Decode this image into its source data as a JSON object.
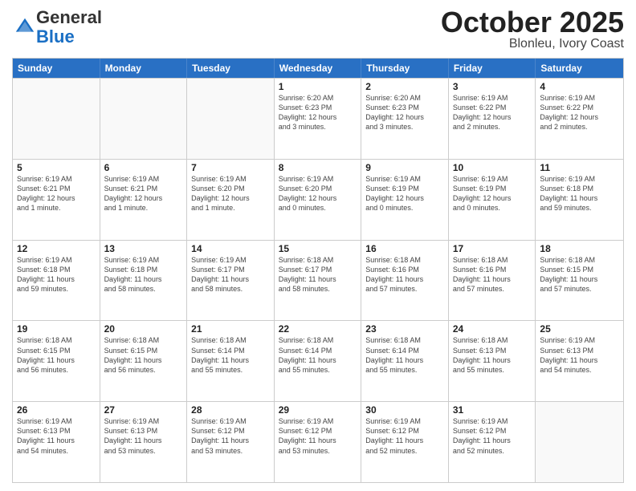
{
  "logo": {
    "general": "General",
    "blue": "Blue"
  },
  "header": {
    "month": "October 2025",
    "location": "Blonleu, Ivory Coast"
  },
  "weekdays": [
    "Sunday",
    "Monday",
    "Tuesday",
    "Wednesday",
    "Thursday",
    "Friday",
    "Saturday"
  ],
  "weeks": [
    [
      {
        "day": "",
        "info": ""
      },
      {
        "day": "",
        "info": ""
      },
      {
        "day": "",
        "info": ""
      },
      {
        "day": "1",
        "info": "Sunrise: 6:20 AM\nSunset: 6:23 PM\nDaylight: 12 hours\nand 3 minutes."
      },
      {
        "day": "2",
        "info": "Sunrise: 6:20 AM\nSunset: 6:23 PM\nDaylight: 12 hours\nand 3 minutes."
      },
      {
        "day": "3",
        "info": "Sunrise: 6:19 AM\nSunset: 6:22 PM\nDaylight: 12 hours\nand 2 minutes."
      },
      {
        "day": "4",
        "info": "Sunrise: 6:19 AM\nSunset: 6:22 PM\nDaylight: 12 hours\nand 2 minutes."
      }
    ],
    [
      {
        "day": "5",
        "info": "Sunrise: 6:19 AM\nSunset: 6:21 PM\nDaylight: 12 hours\nand 1 minute."
      },
      {
        "day": "6",
        "info": "Sunrise: 6:19 AM\nSunset: 6:21 PM\nDaylight: 12 hours\nand 1 minute."
      },
      {
        "day": "7",
        "info": "Sunrise: 6:19 AM\nSunset: 6:20 PM\nDaylight: 12 hours\nand 1 minute."
      },
      {
        "day": "8",
        "info": "Sunrise: 6:19 AM\nSunset: 6:20 PM\nDaylight: 12 hours\nand 0 minutes."
      },
      {
        "day": "9",
        "info": "Sunrise: 6:19 AM\nSunset: 6:19 PM\nDaylight: 12 hours\nand 0 minutes."
      },
      {
        "day": "10",
        "info": "Sunrise: 6:19 AM\nSunset: 6:19 PM\nDaylight: 12 hours\nand 0 minutes."
      },
      {
        "day": "11",
        "info": "Sunrise: 6:19 AM\nSunset: 6:18 PM\nDaylight: 11 hours\nand 59 minutes."
      }
    ],
    [
      {
        "day": "12",
        "info": "Sunrise: 6:19 AM\nSunset: 6:18 PM\nDaylight: 11 hours\nand 59 minutes."
      },
      {
        "day": "13",
        "info": "Sunrise: 6:19 AM\nSunset: 6:18 PM\nDaylight: 11 hours\nand 58 minutes."
      },
      {
        "day": "14",
        "info": "Sunrise: 6:19 AM\nSunset: 6:17 PM\nDaylight: 11 hours\nand 58 minutes."
      },
      {
        "day": "15",
        "info": "Sunrise: 6:18 AM\nSunset: 6:17 PM\nDaylight: 11 hours\nand 58 minutes."
      },
      {
        "day": "16",
        "info": "Sunrise: 6:18 AM\nSunset: 6:16 PM\nDaylight: 11 hours\nand 57 minutes."
      },
      {
        "day": "17",
        "info": "Sunrise: 6:18 AM\nSunset: 6:16 PM\nDaylight: 11 hours\nand 57 minutes."
      },
      {
        "day": "18",
        "info": "Sunrise: 6:18 AM\nSunset: 6:15 PM\nDaylight: 11 hours\nand 57 minutes."
      }
    ],
    [
      {
        "day": "19",
        "info": "Sunrise: 6:18 AM\nSunset: 6:15 PM\nDaylight: 11 hours\nand 56 minutes."
      },
      {
        "day": "20",
        "info": "Sunrise: 6:18 AM\nSunset: 6:15 PM\nDaylight: 11 hours\nand 56 minutes."
      },
      {
        "day": "21",
        "info": "Sunrise: 6:18 AM\nSunset: 6:14 PM\nDaylight: 11 hours\nand 55 minutes."
      },
      {
        "day": "22",
        "info": "Sunrise: 6:18 AM\nSunset: 6:14 PM\nDaylight: 11 hours\nand 55 minutes."
      },
      {
        "day": "23",
        "info": "Sunrise: 6:18 AM\nSunset: 6:14 PM\nDaylight: 11 hours\nand 55 minutes."
      },
      {
        "day": "24",
        "info": "Sunrise: 6:18 AM\nSunset: 6:13 PM\nDaylight: 11 hours\nand 55 minutes."
      },
      {
        "day": "25",
        "info": "Sunrise: 6:19 AM\nSunset: 6:13 PM\nDaylight: 11 hours\nand 54 minutes."
      }
    ],
    [
      {
        "day": "26",
        "info": "Sunrise: 6:19 AM\nSunset: 6:13 PM\nDaylight: 11 hours\nand 54 minutes."
      },
      {
        "day": "27",
        "info": "Sunrise: 6:19 AM\nSunset: 6:13 PM\nDaylight: 11 hours\nand 53 minutes."
      },
      {
        "day": "28",
        "info": "Sunrise: 6:19 AM\nSunset: 6:12 PM\nDaylight: 11 hours\nand 53 minutes."
      },
      {
        "day": "29",
        "info": "Sunrise: 6:19 AM\nSunset: 6:12 PM\nDaylight: 11 hours\nand 53 minutes."
      },
      {
        "day": "30",
        "info": "Sunrise: 6:19 AM\nSunset: 6:12 PM\nDaylight: 11 hours\nand 52 minutes."
      },
      {
        "day": "31",
        "info": "Sunrise: 6:19 AM\nSunset: 6:12 PM\nDaylight: 11 hours\nand 52 minutes."
      },
      {
        "day": "",
        "info": ""
      }
    ]
  ]
}
